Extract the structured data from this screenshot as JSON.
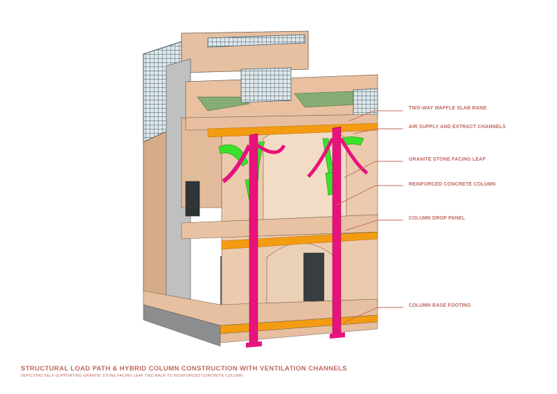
{
  "labels": {
    "waffle_slab": "TWO-WAY WAFFLE SLAB BAND",
    "air_channels": "AIR SUPPLY AND EXTRACT CHANNELS",
    "granite_leaf": "GRANITE STONE FACING LEAF",
    "rc_column": "REINFORCED CONCRETE COLUMN",
    "drop_panel": "COLUMN DROP PANEL",
    "base_footing": "COLUMN BASE FOOTING"
  },
  "title": "STRUCTURAL LOAD PATH & HYBRID COLUMN CONSTRUCTION WITH VENTILATION CHANNELS",
  "subtitle": "DEPICTING SELF-SUPPORTING GRANITE STONE FACING LEAF TIED BACK TO REINFORCED CONCRETE COLUMN",
  "colors": {
    "accent_text": "#c0675f",
    "column": "#e8127c",
    "ventilation": "#f39c12",
    "granite": "#39e12b",
    "stone": "#e9c3a4",
    "roof_green": "#7fa86b",
    "glazing": "#4a6b76"
  }
}
